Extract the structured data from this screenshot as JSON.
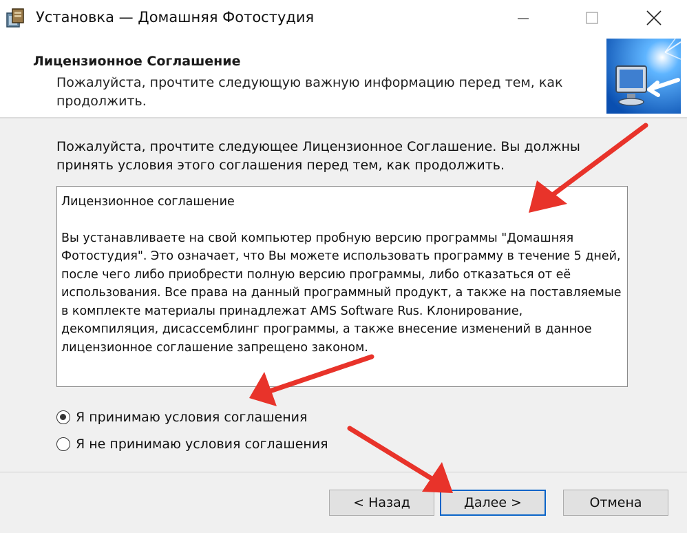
{
  "window": {
    "title": "Установка — Домашняя Фотостудия"
  },
  "header": {
    "title": "Лицензионное Соглашение",
    "subtitle": "Пожалуйста, прочтите следующую важную информацию перед тем, как продолжить."
  },
  "content": {
    "intro": "Пожалуйста, прочтите следующее Лицензионное Соглашение. Вы должны принять условия этого соглашения перед тем, как продолжить.",
    "license_heading": "Лицензионное соглашение",
    "license_body": "Вы устанавливаете на свой компьютер пробную версию программы \"Домашняя Фотостудия\". Это означает, что Вы можете использовать программу в течение 5 дней, после чего либо приобрести полную версию программы, либо отказаться от её использования. Все права на данный программный продукт, а также на поставляемые в комплекте материалы принадлежат AMS Software Rus. Клонирование, декомпиляция, дисассемблинг программы, а также внесение изменений в данное лицензионное соглашение запрещено законом."
  },
  "options": {
    "accept": "Я принимаю условия соглашения",
    "decline": "Я не принимаю условия соглашения",
    "selected": "accept"
  },
  "buttons": {
    "back": "< Назад",
    "next": "Далее >",
    "cancel": "Отмена"
  },
  "icons": {
    "app": "installer-icon",
    "header": "monitor-arrow-icon",
    "minimize": "minimize-icon",
    "maximize": "maximize-icon",
    "close": "close-icon"
  },
  "colors": {
    "annotation_arrow": "#e8332a",
    "primary_border": "#0a64c8"
  }
}
